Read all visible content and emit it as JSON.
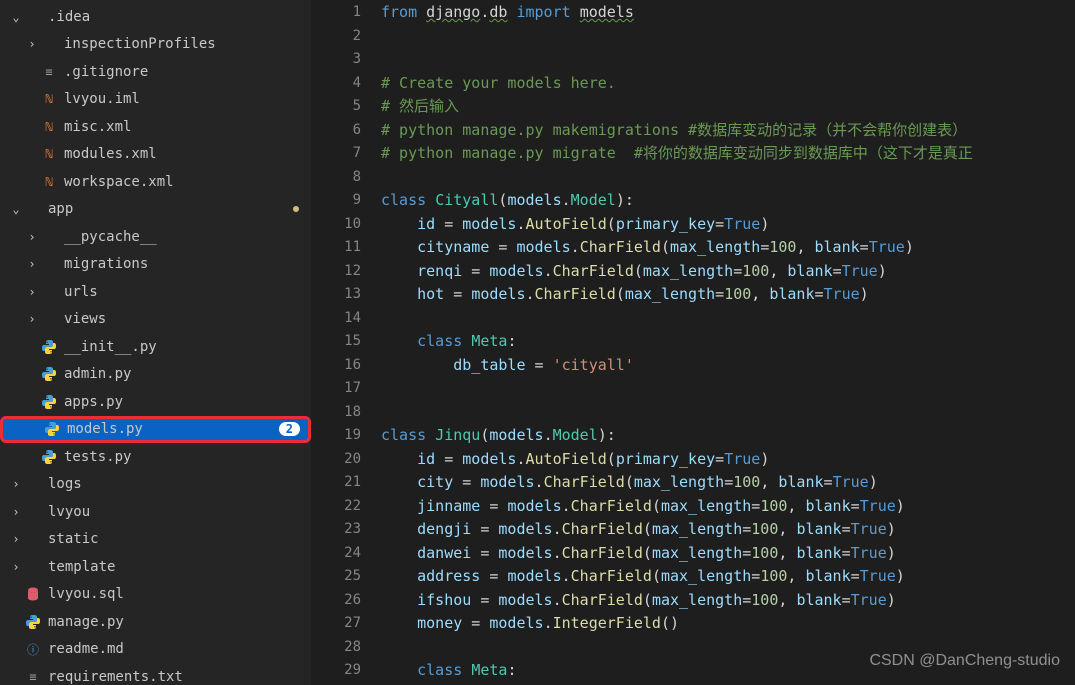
{
  "sidebar": {
    "items": [
      {
        "indent": 0,
        "chev": "down",
        "icon": "folder",
        "label": ".idea"
      },
      {
        "indent": 1,
        "chev": "right",
        "icon": "folder",
        "label": "inspectionProfiles"
      },
      {
        "indent": 1,
        "chev": "",
        "icon": "txt",
        "label": ".gitignore"
      },
      {
        "indent": 1,
        "chev": "",
        "icon": "xml",
        "label": "lvyou.iml"
      },
      {
        "indent": 1,
        "chev": "",
        "icon": "xml",
        "label": "misc.xml"
      },
      {
        "indent": 1,
        "chev": "",
        "icon": "xml",
        "label": "modules.xml"
      },
      {
        "indent": 1,
        "chev": "",
        "icon": "xml",
        "label": "workspace.xml"
      },
      {
        "indent": 0,
        "chev": "down",
        "icon": "folder",
        "label": "app",
        "dot": true
      },
      {
        "indent": 1,
        "chev": "right",
        "icon": "folder",
        "label": "__pycache__"
      },
      {
        "indent": 1,
        "chev": "right",
        "icon": "folder",
        "label": "migrations"
      },
      {
        "indent": 1,
        "chev": "right",
        "icon": "folder",
        "label": "urls"
      },
      {
        "indent": 1,
        "chev": "right",
        "icon": "folder",
        "label": "views"
      },
      {
        "indent": 1,
        "chev": "",
        "icon": "py",
        "label": "__init__.py"
      },
      {
        "indent": 1,
        "chev": "",
        "icon": "py",
        "label": "admin.py"
      },
      {
        "indent": 1,
        "chev": "",
        "icon": "py",
        "label": "apps.py"
      },
      {
        "indent": 1,
        "chev": "",
        "icon": "py",
        "label": "models.py",
        "selected": true,
        "badge": "2",
        "highlight": true
      },
      {
        "indent": 1,
        "chev": "",
        "icon": "py",
        "label": "tests.py"
      },
      {
        "indent": 0,
        "chev": "right",
        "icon": "folder",
        "label": "logs"
      },
      {
        "indent": 0,
        "chev": "right",
        "icon": "folder",
        "label": "lvyou"
      },
      {
        "indent": 0,
        "chev": "right",
        "icon": "folder",
        "label": "static"
      },
      {
        "indent": 0,
        "chev": "right",
        "icon": "folder",
        "label": "template"
      },
      {
        "indent": 0,
        "chev": "",
        "icon": "sql",
        "label": "lvyou.sql"
      },
      {
        "indent": 0,
        "chev": "",
        "icon": "py",
        "label": "manage.py"
      },
      {
        "indent": 0,
        "chev": "",
        "icon": "md",
        "label": "readme.md"
      },
      {
        "indent": 0,
        "chev": "",
        "icon": "txt",
        "label": "requirements.txt"
      }
    ]
  },
  "code": {
    "lines": [
      [
        [
          "kw",
          "from"
        ],
        [
          "op",
          " "
        ],
        [
          "underline",
          "django"
        ],
        [
          "op",
          "."
        ],
        [
          "underline",
          "db"
        ],
        [
          "op",
          " "
        ],
        [
          "kw",
          "import"
        ],
        [
          "op",
          " "
        ],
        [
          "underline",
          "models"
        ]
      ],
      [],
      [],
      [
        [
          "comment",
          "# Create your models here."
        ]
      ],
      [
        [
          "comment",
          "# 然后输入"
        ]
      ],
      [
        [
          "comment",
          "# python manage.py makemigrations #数据库变动的记录（并不会帮你创建表）"
        ]
      ],
      [
        [
          "comment",
          "# python manage.py migrate  #将你的数据库变动同步到数据库中（这下才是真正"
        ]
      ],
      [],
      [
        [
          "kw",
          "class"
        ],
        [
          "op",
          " "
        ],
        [
          "cls",
          "Cityall"
        ],
        [
          "op",
          "("
        ],
        [
          "param",
          "models"
        ],
        [
          "op",
          "."
        ],
        [
          "cls",
          "Model"
        ],
        [
          "op",
          "):"
        ]
      ],
      [
        [
          "op",
          "    "
        ],
        [
          "param",
          "id"
        ],
        [
          "op",
          " = "
        ],
        [
          "param",
          "models"
        ],
        [
          "op",
          "."
        ],
        [
          "fn",
          "AutoField"
        ],
        [
          "op",
          "("
        ],
        [
          "param",
          "primary_key"
        ],
        [
          "op",
          "="
        ],
        [
          "const",
          "True"
        ],
        [
          "op",
          ")"
        ]
      ],
      [
        [
          "op",
          "    "
        ],
        [
          "param",
          "cityname"
        ],
        [
          "op",
          " = "
        ],
        [
          "param",
          "models"
        ],
        [
          "op",
          "."
        ],
        [
          "fn",
          "CharField"
        ],
        [
          "op",
          "("
        ],
        [
          "param",
          "max_length"
        ],
        [
          "op",
          "="
        ],
        [
          "num",
          "100"
        ],
        [
          "op",
          ", "
        ],
        [
          "param",
          "blank"
        ],
        [
          "op",
          "="
        ],
        [
          "const",
          "True"
        ],
        [
          "op",
          ")"
        ]
      ],
      [
        [
          "op",
          "    "
        ],
        [
          "param",
          "renqi"
        ],
        [
          "op",
          " = "
        ],
        [
          "param",
          "models"
        ],
        [
          "op",
          "."
        ],
        [
          "fn",
          "CharField"
        ],
        [
          "op",
          "("
        ],
        [
          "param",
          "max_length"
        ],
        [
          "op",
          "="
        ],
        [
          "num",
          "100"
        ],
        [
          "op",
          ", "
        ],
        [
          "param",
          "blank"
        ],
        [
          "op",
          "="
        ],
        [
          "const",
          "True"
        ],
        [
          "op",
          ")"
        ]
      ],
      [
        [
          "op",
          "    "
        ],
        [
          "param",
          "hot"
        ],
        [
          "op",
          " = "
        ],
        [
          "param",
          "models"
        ],
        [
          "op",
          "."
        ],
        [
          "fn",
          "CharField"
        ],
        [
          "op",
          "("
        ],
        [
          "param",
          "max_length"
        ],
        [
          "op",
          "="
        ],
        [
          "num",
          "100"
        ],
        [
          "op",
          ", "
        ],
        [
          "param",
          "blank"
        ],
        [
          "op",
          "="
        ],
        [
          "const",
          "True"
        ],
        [
          "op",
          ")"
        ]
      ],
      [],
      [
        [
          "op",
          "    "
        ],
        [
          "kw",
          "class"
        ],
        [
          "op",
          " "
        ],
        [
          "cls",
          "Meta"
        ],
        [
          "op",
          ":"
        ]
      ],
      [
        [
          "op",
          "        "
        ],
        [
          "param",
          "db_table"
        ],
        [
          "op",
          " = "
        ],
        [
          "str",
          "'cityall'"
        ]
      ],
      [],
      [],
      [
        [
          "kw",
          "class"
        ],
        [
          "op",
          " "
        ],
        [
          "cls",
          "Jinqu"
        ],
        [
          "op",
          "("
        ],
        [
          "param",
          "models"
        ],
        [
          "op",
          "."
        ],
        [
          "cls",
          "Model"
        ],
        [
          "op",
          "):"
        ]
      ],
      [
        [
          "op",
          "    "
        ],
        [
          "param",
          "id"
        ],
        [
          "op",
          " = "
        ],
        [
          "param",
          "models"
        ],
        [
          "op",
          "."
        ],
        [
          "fn",
          "AutoField"
        ],
        [
          "op",
          "("
        ],
        [
          "param",
          "primary_key"
        ],
        [
          "op",
          "="
        ],
        [
          "const",
          "True"
        ],
        [
          "op",
          ")"
        ]
      ],
      [
        [
          "op",
          "    "
        ],
        [
          "param",
          "city"
        ],
        [
          "op",
          " = "
        ],
        [
          "param",
          "models"
        ],
        [
          "op",
          "."
        ],
        [
          "fn",
          "CharField"
        ],
        [
          "op",
          "("
        ],
        [
          "param",
          "max_length"
        ],
        [
          "op",
          "="
        ],
        [
          "num",
          "100"
        ],
        [
          "op",
          ", "
        ],
        [
          "param",
          "blank"
        ],
        [
          "op",
          "="
        ],
        [
          "const",
          "True"
        ],
        [
          "op",
          ")"
        ]
      ],
      [
        [
          "op",
          "    "
        ],
        [
          "param",
          "jinname"
        ],
        [
          "op",
          " = "
        ],
        [
          "param",
          "models"
        ],
        [
          "op",
          "."
        ],
        [
          "fn",
          "CharField"
        ],
        [
          "op",
          "("
        ],
        [
          "param",
          "max_length"
        ],
        [
          "op",
          "="
        ],
        [
          "num",
          "100"
        ],
        [
          "op",
          ", "
        ],
        [
          "param",
          "blank"
        ],
        [
          "op",
          "="
        ],
        [
          "const",
          "True"
        ],
        [
          "op",
          ")"
        ]
      ],
      [
        [
          "op",
          "    "
        ],
        [
          "param",
          "dengji"
        ],
        [
          "op",
          " = "
        ],
        [
          "param",
          "models"
        ],
        [
          "op",
          "."
        ],
        [
          "fn",
          "CharField"
        ],
        [
          "op",
          "("
        ],
        [
          "param",
          "max_length"
        ],
        [
          "op",
          "="
        ],
        [
          "num",
          "100"
        ],
        [
          "op",
          ", "
        ],
        [
          "param",
          "blank"
        ],
        [
          "op",
          "="
        ],
        [
          "const",
          "True"
        ],
        [
          "op",
          ")"
        ]
      ],
      [
        [
          "op",
          "    "
        ],
        [
          "param",
          "danwei"
        ],
        [
          "op",
          " = "
        ],
        [
          "param",
          "models"
        ],
        [
          "op",
          "."
        ],
        [
          "fn",
          "CharField"
        ],
        [
          "op",
          "("
        ],
        [
          "param",
          "max_length"
        ],
        [
          "op",
          "="
        ],
        [
          "num",
          "100"
        ],
        [
          "op",
          ", "
        ],
        [
          "param",
          "blank"
        ],
        [
          "op",
          "="
        ],
        [
          "const",
          "True"
        ],
        [
          "op",
          ")"
        ]
      ],
      [
        [
          "op",
          "    "
        ],
        [
          "param",
          "address"
        ],
        [
          "op",
          " = "
        ],
        [
          "param",
          "models"
        ],
        [
          "op",
          "."
        ],
        [
          "fn",
          "CharField"
        ],
        [
          "op",
          "("
        ],
        [
          "param",
          "max_length"
        ],
        [
          "op",
          "="
        ],
        [
          "num",
          "100"
        ],
        [
          "op",
          ", "
        ],
        [
          "param",
          "blank"
        ],
        [
          "op",
          "="
        ],
        [
          "const",
          "True"
        ],
        [
          "op",
          ")"
        ]
      ],
      [
        [
          "op",
          "    "
        ],
        [
          "param",
          "ifshou"
        ],
        [
          "op",
          " = "
        ],
        [
          "param",
          "models"
        ],
        [
          "op",
          "."
        ],
        [
          "fn",
          "CharField"
        ],
        [
          "op",
          "("
        ],
        [
          "param",
          "max_length"
        ],
        [
          "op",
          "="
        ],
        [
          "num",
          "100"
        ],
        [
          "op",
          ", "
        ],
        [
          "param",
          "blank"
        ],
        [
          "op",
          "="
        ],
        [
          "const",
          "True"
        ],
        [
          "op",
          ")"
        ]
      ],
      [
        [
          "op",
          "    "
        ],
        [
          "param",
          "money"
        ],
        [
          "op",
          " = "
        ],
        [
          "param",
          "models"
        ],
        [
          "op",
          "."
        ],
        [
          "fn",
          "IntegerField"
        ],
        [
          "op",
          "()"
        ]
      ],
      [],
      [
        [
          "op",
          "    "
        ],
        [
          "kw",
          "class"
        ],
        [
          "op",
          " "
        ],
        [
          "cls",
          "Meta"
        ],
        [
          "op",
          ":"
        ]
      ]
    ]
  },
  "watermark": "CSDN @DanCheng-studio"
}
